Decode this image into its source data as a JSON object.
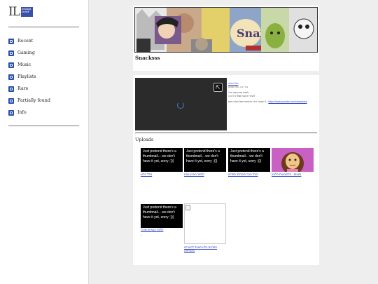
{
  "sidebar": {
    "logo": {
      "letters": "IL",
      "box_text": "Nostalgia Archive"
    },
    "items": [
      {
        "label": "Recent",
        "icon": "clock-icon"
      },
      {
        "label": "Gaming",
        "icon": "gamepad-icon"
      },
      {
        "label": "Music",
        "icon": "headphones-icon"
      },
      {
        "label": "Playlists",
        "icon": "playlist-icon"
      },
      {
        "label": "Rare",
        "icon": "gem-icon"
      },
      {
        "label": "Partially found",
        "icon": "pencil-icon"
      },
      {
        "label": "Info",
        "icon": "question-icon"
      }
    ]
  },
  "channel": {
    "name": "Snacksss",
    "banner_text": "Snax"
  },
  "about": {
    "line1": "גולל וואלה",
    "line2": "ב.ד. כ.ב. גולל אצלנו",
    "line3": "לשבח ואדון שבו גורל",
    "line4": "לאתר תרובות שפורה ל.ה.ה",
    "line5_prefix": "לי שוטף. כתר הבחאות ושלו אולם האם - ",
    "link": "https://www.youtube.com/c/snacksss"
  },
  "uploads": {
    "title": "Uploads",
    "placeholder_text": "Just pretend there's a thumbnail... we don't have it yet, sorry :)))",
    "videos": [
      {
        "caption": "גולל הלוא"
      },
      {
        "caption": "לגמור הארץ שבע"
      },
      {
        "caption": "הורד הבה פוהחלב ספראו"
      },
      {
        "caption": "בעעום - הלהובאות הלעיון"
      },
      {
        "caption": "לזלות הבאיות שורה"
      },
      {
        "caption": "המרעת הלט מאיגד לכגע לא באנדזאה"
      }
    ],
    "extra_mark": "."
  },
  "colors": {
    "accent": "#2a4fa8",
    "link": "#2540c0",
    "background": "#eeeeee"
  }
}
